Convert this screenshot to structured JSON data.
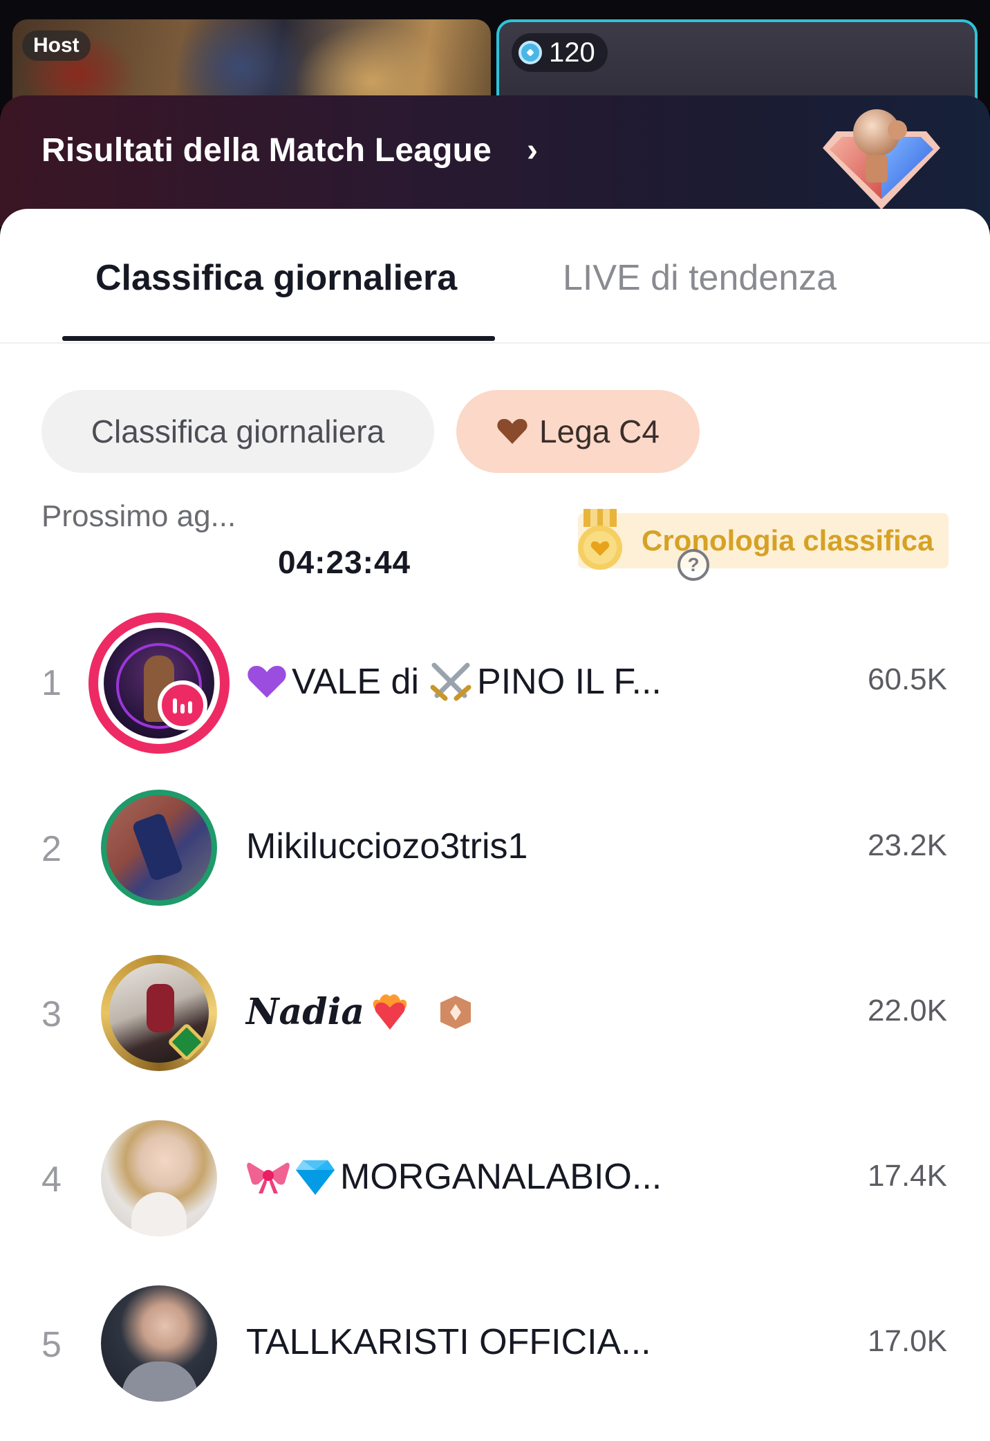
{
  "top": {
    "host_label": "Host",
    "opponent_score": "120"
  },
  "banner": {
    "title": "Risultati della Match League",
    "chevron": "›"
  },
  "tabs": [
    {
      "label": "Classifica giornaliera",
      "active": true
    },
    {
      "label": "LIVE di tendenza",
      "active": false
    }
  ],
  "chips": {
    "daily": "Classifica giornaliera",
    "league": "Lega C4"
  },
  "timer": {
    "label": "Prossimo ag...",
    "countdown": "04:23:44"
  },
  "history": {
    "label": "Cronologia classifica",
    "help": "?"
  },
  "ranking": [
    {
      "rank": "1",
      "name": "VALE di",
      "name_rest": "PINO IL F...",
      "score": "60.5K",
      "is_live": true
    },
    {
      "rank": "2",
      "name": "Mikilucciozo3tris1",
      "score": "23.2K"
    },
    {
      "rank": "3",
      "name": "Nadia",
      "score": "22.0K"
    },
    {
      "rank": "4",
      "name": "MORGANALABIO...",
      "score": "17.4K"
    },
    {
      "rank": "5",
      "name": "TALLKARISTI OFFICIA...",
      "score": "17.0K"
    }
  ],
  "colors": {
    "accent_live": "#ee2a64",
    "league_chip": "#fbd8c8",
    "history_text": "#d6a125",
    "opponent_border": "#2fc3d8"
  },
  "icons": [
    "coin-icon",
    "trophy-icon",
    "heart-icon",
    "medal-icon",
    "help-icon",
    "live-icon",
    "purple-heart-emoji",
    "crossed-swords-emoji",
    "heart-on-fire-emoji",
    "rank-badge-icon",
    "ribbon-emoji",
    "gem-emoji"
  ]
}
